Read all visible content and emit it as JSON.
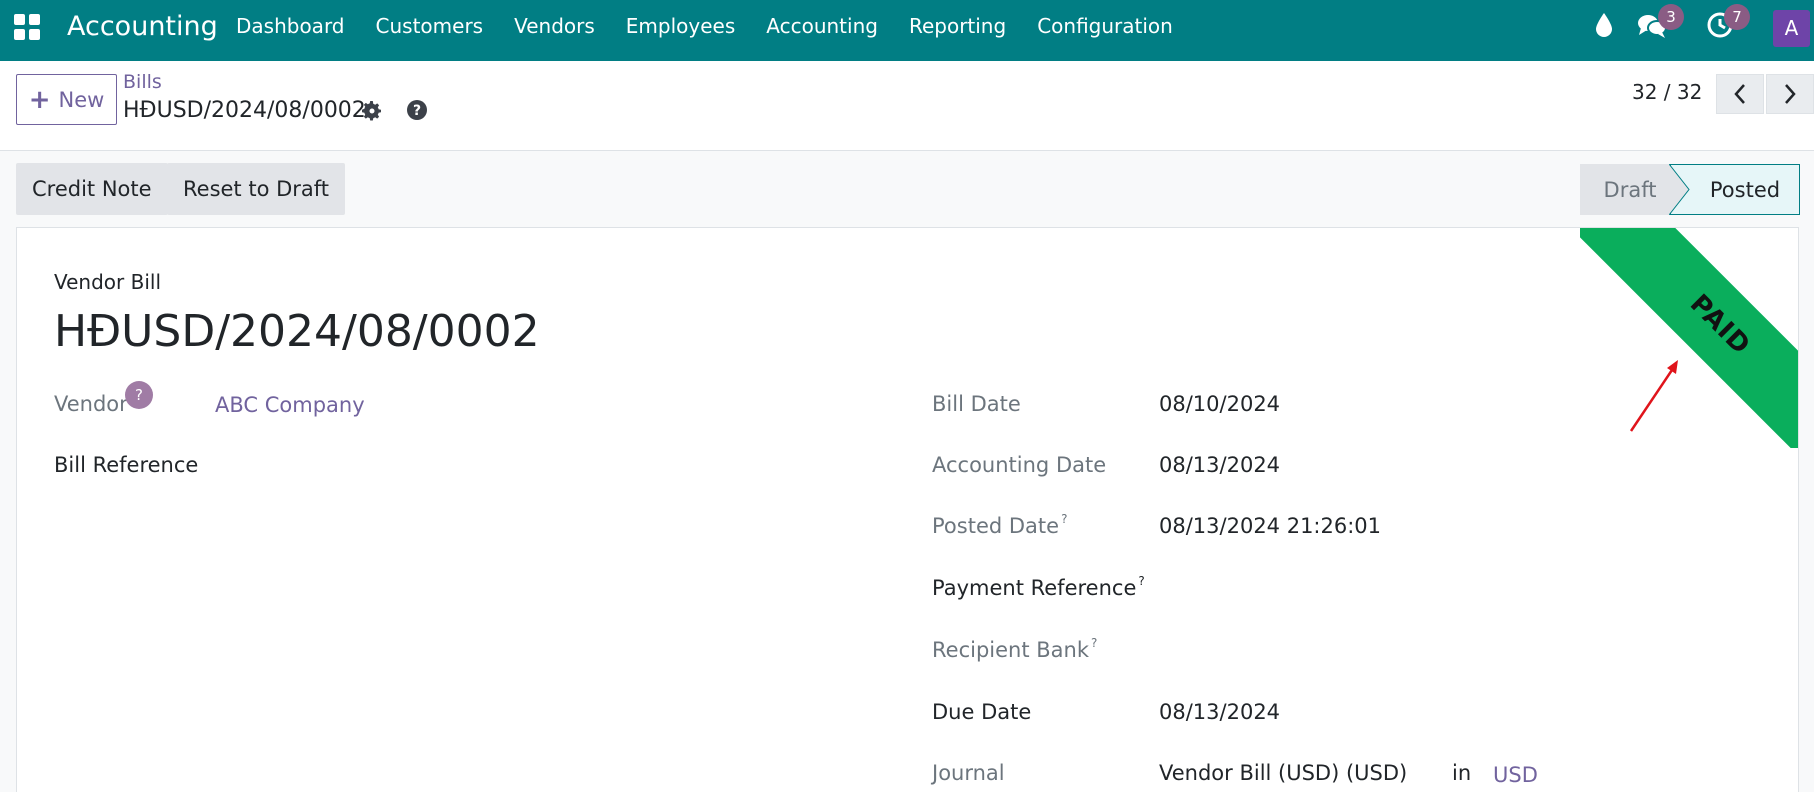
{
  "navbar": {
    "app_title": "Accounting",
    "menu": [
      "Dashboard",
      "Customers",
      "Vendors",
      "Employees",
      "Accounting",
      "Reporting",
      "Configuration"
    ],
    "chat_count": "3",
    "activity_count": "7",
    "avatar_letter": "A",
    "color": "#017e84"
  },
  "control": {
    "new_label": "New",
    "breadcrumb_parent": "Bills",
    "breadcrumb_current": "HĐUSD/2024/08/0002",
    "pager": "32 / 32"
  },
  "statusbar": {
    "credit_note_label": "Credit Note",
    "reset_label": "Reset to Draft",
    "stages": [
      "Draft",
      "Posted"
    ],
    "active_stage": "Posted"
  },
  "sheet": {
    "doc_type": "Vendor Bill",
    "doc_name": "HĐUSD/2024/08/0002",
    "ribbon": "PAID",
    "vendor_label": "Vendor",
    "vendor_help": "?",
    "vendor_value": "ABC Company",
    "bill_reference_label": "Bill Reference",
    "bill_date_label": "Bill Date",
    "bill_date_value": "08/10/2024",
    "accounting_date_label": "Accounting Date",
    "accounting_date_value": "08/13/2024",
    "posted_date_label": "Posted Date",
    "posted_date_value": "08/13/2024 21:26:01",
    "payment_reference_label": "Payment Reference",
    "recipient_bank_label": "Recipient Bank",
    "due_date_label": "Due Date",
    "due_date_value": "08/13/2024",
    "journal_label": "Journal",
    "journal_value": "Vendor Bill (USD) (USD)",
    "journal_in": "in",
    "journal_currency": "USD",
    "sup_mark": "?"
  }
}
